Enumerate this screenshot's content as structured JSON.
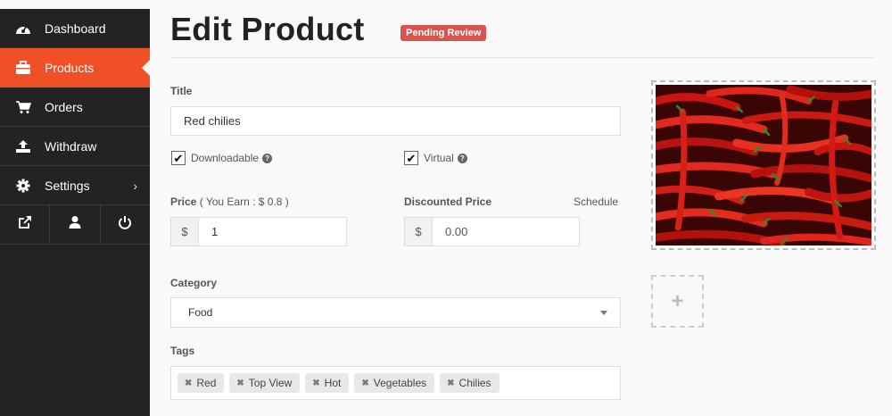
{
  "sidebar": {
    "items": [
      {
        "label": "Dashboard",
        "icon": "dashboard-icon"
      },
      {
        "label": "Products",
        "icon": "briefcase-icon",
        "active": true
      },
      {
        "label": "Orders",
        "icon": "cart-icon"
      },
      {
        "label": "Withdraw",
        "icon": "upload-icon"
      },
      {
        "label": "Settings",
        "icon": "gear-icon"
      }
    ],
    "bottom_icons": [
      "external-link-icon",
      "user-icon",
      "power-icon"
    ]
  },
  "header": {
    "title": "Edit Product",
    "status_badge": "Pending Review"
  },
  "form": {
    "title_label": "Title",
    "title_value": "Red chilies",
    "downloadable_label": "Downloadable",
    "virtual_label": "Virtual",
    "price_label": "Price",
    "price_earn": "( You Earn : $ 0.8 )",
    "currency": "$",
    "price_value": "1",
    "discount_label": "Discounted Price",
    "schedule_label": "Schedule",
    "discount_placeholder": "0.00",
    "category_label": "Category",
    "category_value": "Food",
    "tags_label": "Tags",
    "tags": [
      "Red",
      "Top View",
      "Hot",
      "Vegetables",
      "Chilies"
    ]
  },
  "colors": {
    "accent": "#f05025",
    "sidebar_bg": "#232323",
    "badge": "#d9534f"
  }
}
